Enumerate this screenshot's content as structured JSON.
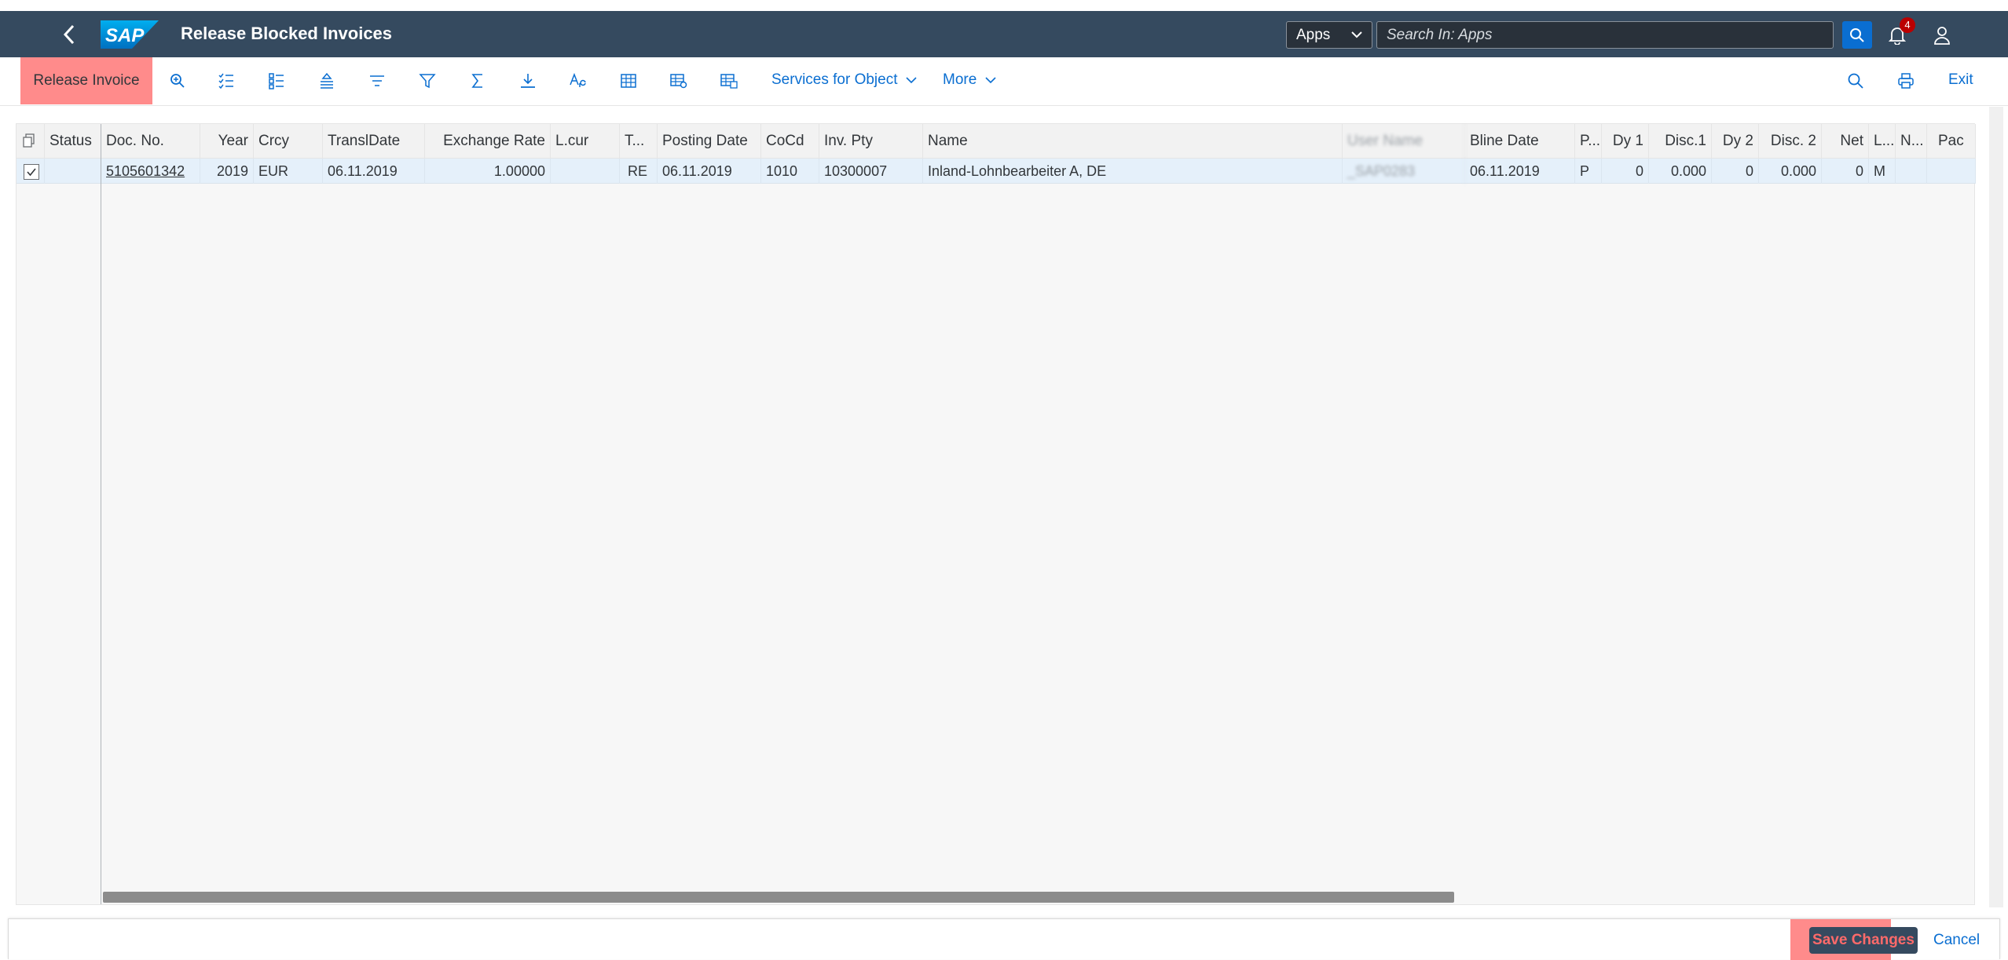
{
  "shell": {
    "title": "Release Blocked Invoices",
    "logo_text": "SAP",
    "apps_select": "Apps",
    "search_placeholder": "Search In: Apps",
    "notification_count": "4"
  },
  "toolbar": {
    "release_label": "Release Invoice",
    "services_label": "Services for Object",
    "more_label": "More",
    "exit_label": "Exit",
    "icons": [
      "zoom-in-icon",
      "checklist-icon",
      "list-detail-icon",
      "align-center-icon",
      "sort-lines-icon",
      "filter-icon",
      "sum-icon",
      "download-icon",
      "spell-check-icon",
      "grid-icon",
      "grid-settings-icon",
      "table-layout-icon"
    ]
  },
  "table": {
    "columns": [
      {
        "key": "status",
        "label": "Status"
      },
      {
        "key": "doc_no",
        "label": "Doc. No."
      },
      {
        "key": "year",
        "label": "Year"
      },
      {
        "key": "crcy",
        "label": "Crcy"
      },
      {
        "key": "transl_date",
        "label": "TranslDate"
      },
      {
        "key": "exchange_rate",
        "label": "Exchange Rate"
      },
      {
        "key": "lcur",
        "label": "L.cur"
      },
      {
        "key": "type",
        "label": "T..."
      },
      {
        "key": "posting_date",
        "label": "Posting Date"
      },
      {
        "key": "cocd",
        "label": "CoCd"
      },
      {
        "key": "inv_pty",
        "label": "Inv. Pty"
      },
      {
        "key": "name",
        "label": "Name"
      },
      {
        "key": "user_name",
        "label": "User Name"
      },
      {
        "key": "bline_date",
        "label": "Bline Date"
      },
      {
        "key": "p",
        "label": "P..."
      },
      {
        "key": "dy1",
        "label": "Dy 1"
      },
      {
        "key": "disc1",
        "label": "Disc.1"
      },
      {
        "key": "dy2",
        "label": "Dy 2"
      },
      {
        "key": "disc2",
        "label": "Disc. 2"
      },
      {
        "key": "net",
        "label": "Net"
      },
      {
        "key": "l",
        "label": "L..."
      },
      {
        "key": "n",
        "label": "N..."
      },
      {
        "key": "pac",
        "label": "Pac"
      }
    ],
    "rows": [
      {
        "status": "",
        "doc_no": "5105601342",
        "year": "2019",
        "crcy": "EUR",
        "transl_date": "06.11.2019",
        "exchange_rate": "1.00000",
        "lcur": "",
        "type": "RE",
        "posting_date": "06.11.2019",
        "cocd": "1010",
        "inv_pty": "10300007",
        "name": "Inland-Lohnbearbeiter A, DE",
        "user_name": "_SAP0283",
        "bline_date": "06.11.2019",
        "p": "P",
        "dy1": "0",
        "disc1": "0.000",
        "dy2": "0",
        "disc2": "0.000",
        "net": "0",
        "l": "M",
        "n": "",
        "pac": ""
      }
    ]
  },
  "footer": {
    "save_label": "Save Changes",
    "cancel_label": "Cancel"
  },
  "colors": {
    "shell_bg": "#354a5f",
    "accent": "#0a6ed1",
    "highlight": "#ff8b8b",
    "selected_row": "#e5f0fa"
  }
}
